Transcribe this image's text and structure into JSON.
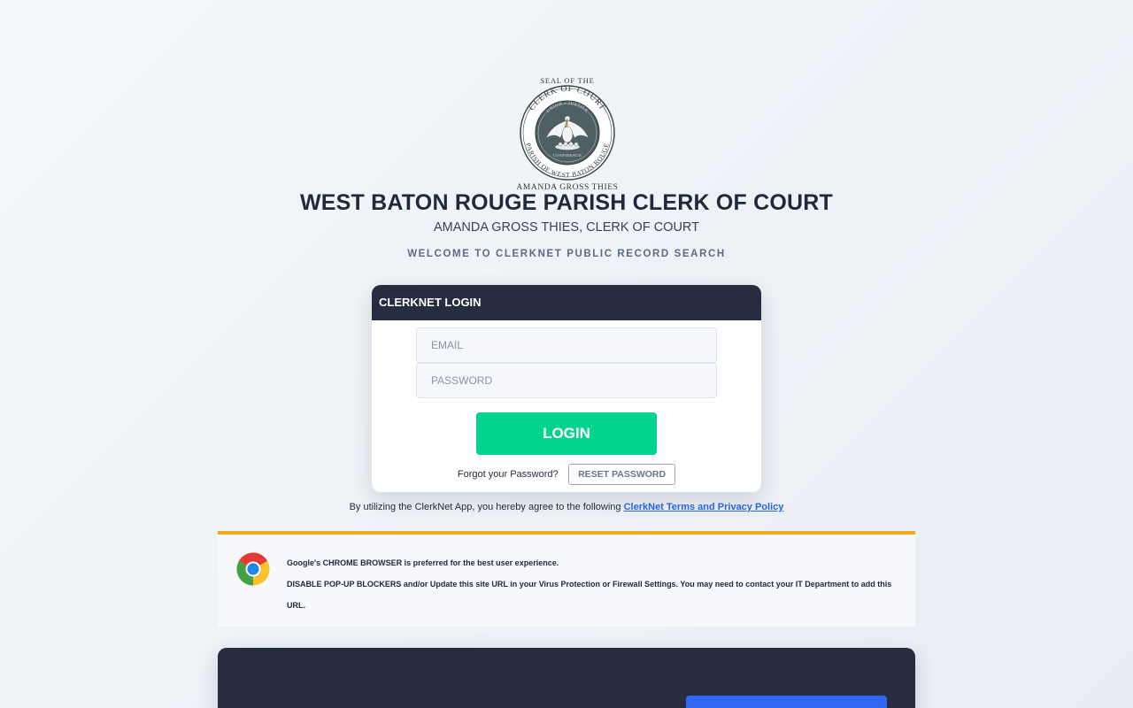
{
  "seal": {
    "top_text": "SEAL OF THE",
    "ring_text": "CLERK OF COURT",
    "bottom_ring_text": "PARISH OF WEST BATON ROUGE",
    "inner_top": "UNION • JUSTICE",
    "inner_bottom": "CONFIDENCE",
    "name": "AMANDA GROSS THIES"
  },
  "header": {
    "title": "WEST BATON ROUGE PARISH CLERK OF COURT",
    "subtitle": "AMANDA GROSS THIES, CLERK OF COURT",
    "welcome": "WELCOME TO CLERKNET PUBLIC RECORD SEARCH"
  },
  "login": {
    "title": "CLERKNET LOGIN",
    "email_placeholder": "EMAIL",
    "password_placeholder": "PASSWORD",
    "login_label": "LOGIN",
    "forgot_text": "Forgot your Password?",
    "reset_label": "RESET PASSWORD"
  },
  "terms": {
    "prefix": "By utilizing the ClerkNet App, you hereby agree to the following",
    "link": "ClerkNet Terms and Privacy Policy"
  },
  "notice": {
    "line1": "Google's CHROME BROWSER is preferred for the best user experience.",
    "line2": "DISABLE POP-UP BLOCKERS and/or Update this site URL in your Virus Protection or Firewall Settings. You may need to contact your IT Department to add this URL.",
    "icon": "chrome-icon",
    "accent_color": "#f2a91a"
  },
  "colors": {
    "header_dark": "#262d40",
    "login_button": "#04d38c",
    "link": "#2563eb",
    "bottom_button": "#2f66f6"
  }
}
